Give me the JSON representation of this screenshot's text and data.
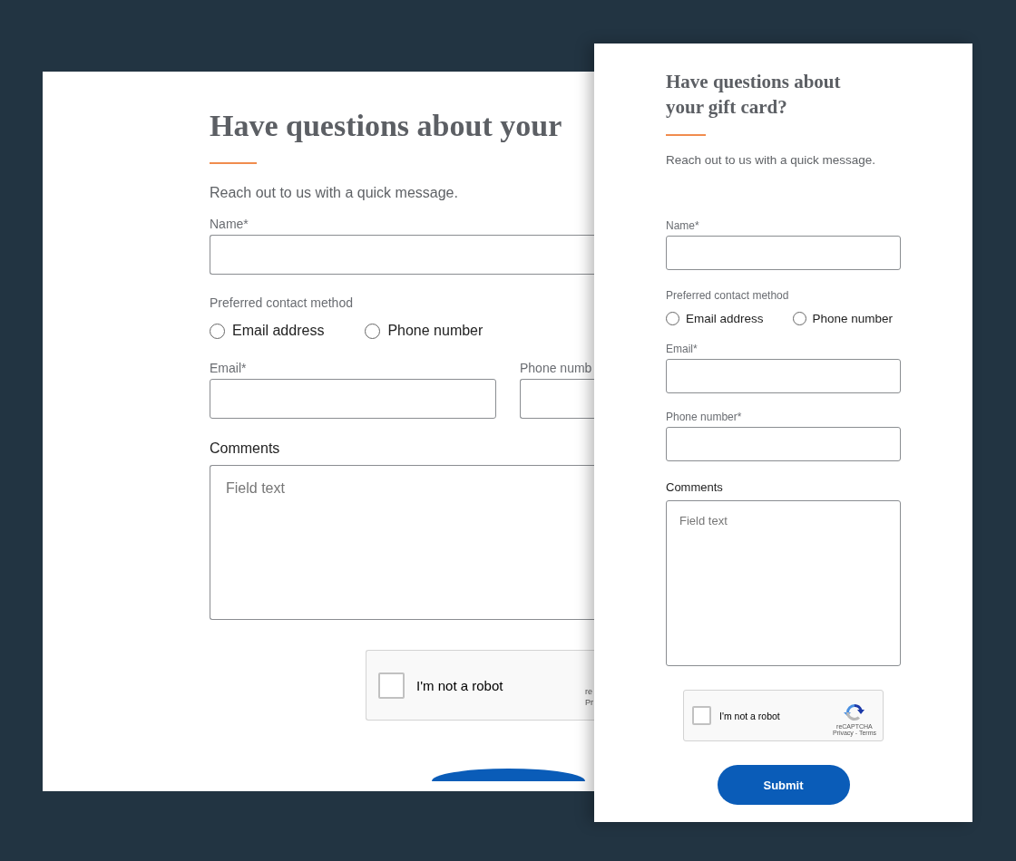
{
  "desktop_form": {
    "heading": "Have questions about your",
    "subtitle": "Reach out to us with a quick message.",
    "name_label": "Name*",
    "contact_label": "Preferred contact method",
    "contact_options": [
      {
        "label": "Email address",
        "selected": false
      },
      {
        "label": "Phone number",
        "selected": false
      }
    ],
    "email_label": "Email*",
    "phone_label": "Phone numb",
    "comments_label": "Comments",
    "comments_placeholder": "Field text",
    "captcha": {
      "label": "I'm not a robot",
      "checked": false,
      "brand": "re",
      "links": "Pr"
    },
    "submit": {
      "kind": "cut"
    }
  },
  "mobile_form": {
    "heading": "Have questions about your gift card?",
    "subtitle": "Reach out to us with a quick message.",
    "name_label": "Name*",
    "contact_label": "Preferred contact method",
    "contact_options": [
      {
        "label": "Email address",
        "selected": false
      },
      {
        "label": "Phone number",
        "selected": false
      }
    ],
    "email_label": "Email*",
    "phone_label": "Phone number*",
    "comments_label": "Comments",
    "comments_placeholder": "Field text",
    "captcha": {
      "label": "I'm not a robot",
      "checked": false,
      "brand": "reCAPTCHA",
      "links": "Privacy - Terms"
    },
    "submit": {
      "kind": "full",
      "label": "Submit"
    }
  }
}
